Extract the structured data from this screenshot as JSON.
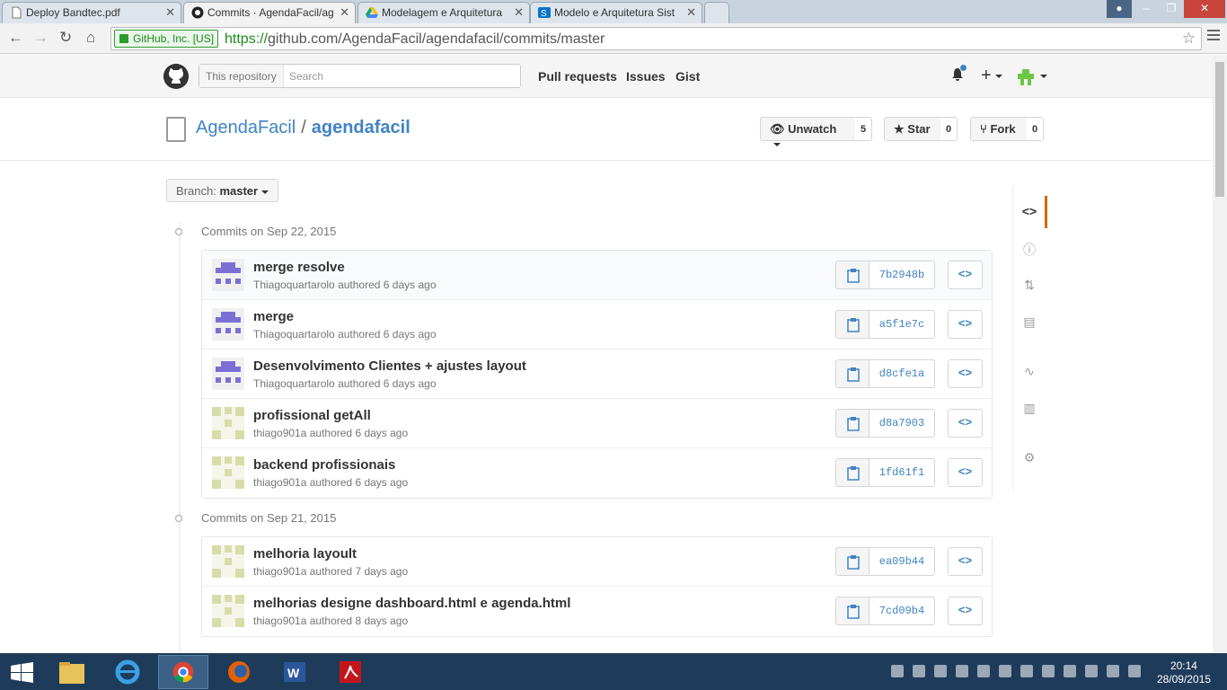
{
  "browser": {
    "tabs": [
      {
        "title": "Deploy Bandtec.pdf",
        "icon": "document-icon"
      },
      {
        "title": "Commits · AgendaFacil/ag",
        "icon": "github-icon",
        "active": true
      },
      {
        "title": "Modelagem e Arquitetura",
        "icon": "drive-icon"
      },
      {
        "title": "Modelo e Arquitetura Sist",
        "icon": "sharepoint-icon"
      }
    ],
    "ev_label": "GitHub, Inc. [US]",
    "url_scheme": "https://",
    "url_rest": "github.com/AgendaFacil/agendafacil/commits/master"
  },
  "header": {
    "scope_label": "This repository",
    "search_placeholder": "Search",
    "nav": [
      "Pull requests",
      "Issues",
      "Gist"
    ]
  },
  "repo": {
    "owner": "AgendaFacil",
    "separator": "/",
    "name": "agendafacil",
    "unwatch_label": "Unwatch",
    "watch_count": "5",
    "star_label": "Star",
    "star_count": "0",
    "fork_label": "Fork",
    "fork_count": "0"
  },
  "branch": {
    "label": "Branch:",
    "name": "master"
  },
  "groups": [
    {
      "date_prefix": "Commits on",
      "date": "Sep 22, 2015",
      "commits": [
        {
          "title": "merge resolve",
          "author": "Thiagoquartarolo",
          "when": "authored 6 days ago",
          "sha": "7b2948b",
          "avatar": "purple"
        },
        {
          "title": "merge",
          "author": "Thiagoquartarolo",
          "when": "authored 6 days ago",
          "sha": "a5f1e7c",
          "avatar": "purple"
        },
        {
          "title": "Desenvolvimento Clientes + ajustes layout",
          "author": "Thiagoquartarolo",
          "when": "authored 6 days ago",
          "sha": "d8cfe1a",
          "avatar": "purple"
        },
        {
          "title": "profissional getAll",
          "author": "thiago901a",
          "when": "authored 6 days ago",
          "sha": "d8a7903",
          "avatar": "olive"
        },
        {
          "title": "backend profissionais",
          "author": "thiago901a",
          "when": "authored 6 days ago",
          "sha": "1fd61f1",
          "avatar": "olive"
        }
      ]
    },
    {
      "date_prefix": "Commits on",
      "date": "Sep 21, 2015",
      "commits": [
        {
          "title": "melhoria layoult",
          "author": "thiago901a",
          "when": "authored 7 days ago",
          "sha": "ea09b44",
          "avatar": "olive"
        },
        {
          "title": "melhorias designe dashboard.html e agenda.html",
          "author": "thiago901a",
          "when": "authored 8 days ago",
          "sha": "7cd09b4",
          "avatar": "olive"
        }
      ]
    }
  ],
  "sidebar_icons": [
    "code-icon",
    "issues-icon",
    "pull-request-icon",
    "wiki-icon",
    "pulse-icon",
    "graphs-icon",
    "settings-icon"
  ],
  "colors": {
    "link": "#4183c4",
    "purple_avatar": "#7b6fd6",
    "olive_avatar": "#d8dca8",
    "active_tab_marker": "#d26911"
  },
  "taskbar": {
    "time": "20:14",
    "date": "28/09/2015"
  }
}
